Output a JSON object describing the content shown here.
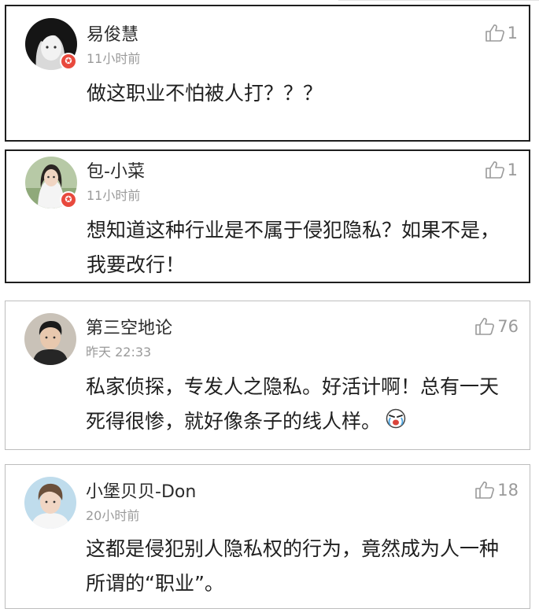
{
  "comments": [
    {
      "username": "易俊慧",
      "time": "11小时前",
      "likes": "1",
      "text": "做这职业不怕被人打？？？",
      "verified": true,
      "avatar_icon": "avatar-girl-dark-hair"
    },
    {
      "username": "包-小菜",
      "time": "11小时前",
      "likes": "1",
      "text": "想知道这种行业是不属于侵犯隐私？如果不是，我要改行！",
      "verified": true,
      "avatar_icon": "avatar-girl-outdoor"
    },
    {
      "username": "第三空地论",
      "time": "昨天 22:33",
      "likes": "76",
      "text": "私家侦探，专发人之隐私。好活计啊！总有一天死得很惨，就好像条子的线人样。",
      "verified": false,
      "avatar_icon": "avatar-man-portrait",
      "emoji_icon": "cry-laugh-emoji"
    },
    {
      "username": "小堡贝贝-Don",
      "time": "20小时前",
      "likes": "18",
      "text": "这都是侵犯别人隐私权的行为，竟然成为人一种所谓的“职业”。",
      "verified": false,
      "avatar_icon": "avatar-young-man"
    }
  ],
  "colors": {
    "username": "#2b2b2b",
    "meta": "#9a9a9a",
    "text": "#1f1f1f",
    "badge": "#e8493d"
  }
}
